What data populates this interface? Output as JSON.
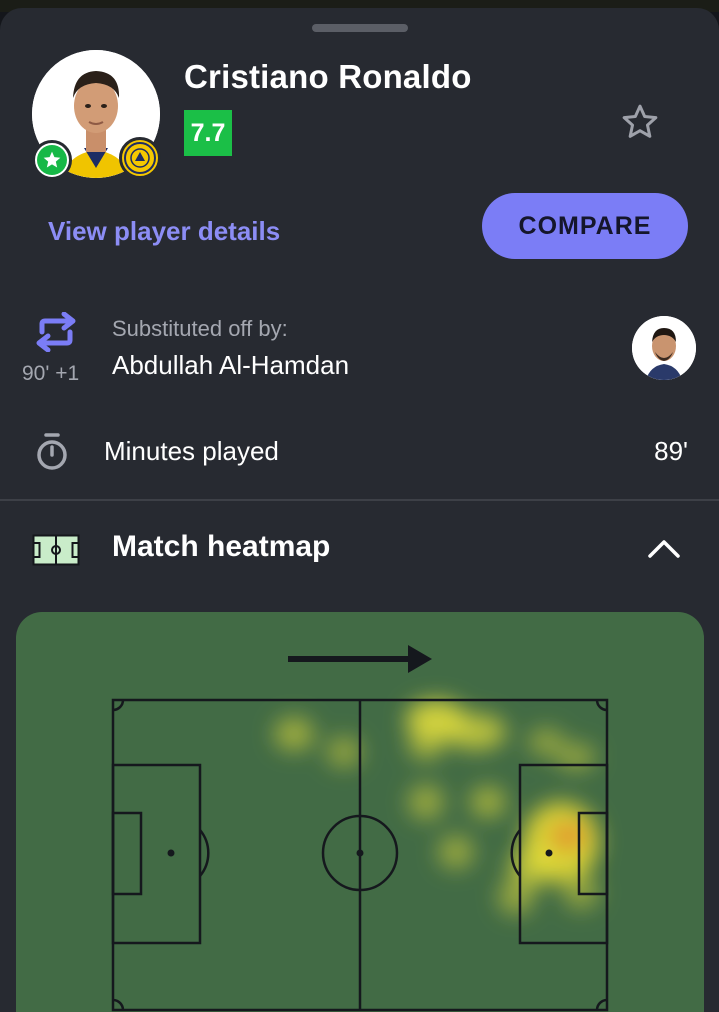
{
  "player": {
    "name": "Cristiano Ronaldo",
    "rating": "7.7",
    "view_details_label": "View player details",
    "compare_label": "COMPARE"
  },
  "substitution": {
    "minute": "90' +1",
    "label": "Substituted off by:",
    "player_name": "Abdullah Al-Hamdan"
  },
  "minutes": {
    "label": "Minutes played",
    "value": "89'"
  },
  "heatmap": {
    "title": "Match heatmap"
  },
  "colors": {
    "accent": "#7b7df6",
    "rating_green": "#1bbf47",
    "pitch": "#426b45"
  },
  "icons": {
    "favorite": "star-outline-icon",
    "substitution": "swap-arrows-icon",
    "timer": "stopwatch-icon",
    "heatmap": "pitch-icon",
    "collapse": "chevron-up-icon",
    "direction": "arrow-right-icon"
  }
}
